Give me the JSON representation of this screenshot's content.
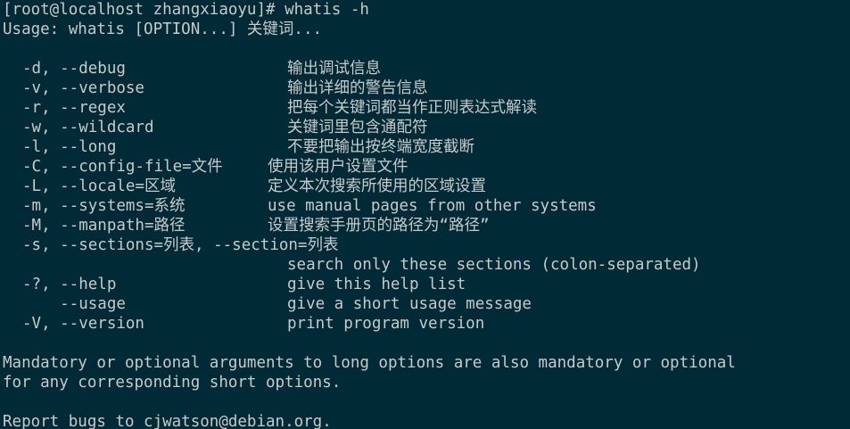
{
  "terminal": {
    "prompt_line": "[root@localhost zhangxiaoyu]# whatis -h",
    "usage_line": "Usage: whatis [OPTION...] 关键词...",
    "options": [
      {
        "flag": "-d, --debug",
        "desc": "输出调试信息"
      },
      {
        "flag": "-v, --verbose",
        "desc": "输出详细的警告信息"
      },
      {
        "flag": "-r, --regex",
        "desc": "把每个关键词都当作正则表达式解读"
      },
      {
        "flag": "-w, --wildcard",
        "desc": "关键词里包含通配符"
      },
      {
        "flag": "-l, --long",
        "desc": "不要把输出按终端宽度截断"
      },
      {
        "flag": "-C, --config-file=文件",
        "desc": "使用该用户设置文件"
      },
      {
        "flag": "-L, --locale=区域",
        "desc": "定义本次搜索所使用的区域设置"
      },
      {
        "flag": "-m, --systems=系统",
        "desc": "use manual pages from other systems"
      },
      {
        "flag": "-M, --manpath=路径",
        "desc": "设置搜索手册页的路径为“路径”"
      },
      {
        "flag": "-s, --sections=列表, --section=列表",
        "desc": ""
      },
      {
        "flag": "",
        "desc": "search only these sections (colon-separated)"
      },
      {
        "flag": "-?, --help",
        "desc": "give this help list"
      },
      {
        "flag": "    --usage",
        "desc": "give a short usage message"
      },
      {
        "flag": "-V, --version",
        "desc": "print program version"
      }
    ],
    "footer_1": "Mandatory or optional arguments to long options are also mandatory or optional",
    "footer_2": "for any corresponding short options.",
    "report": "Report bugs to cjwatson@debian.org."
  },
  "colors": {
    "background": "#002b36",
    "text": "#c9c9c9"
  }
}
